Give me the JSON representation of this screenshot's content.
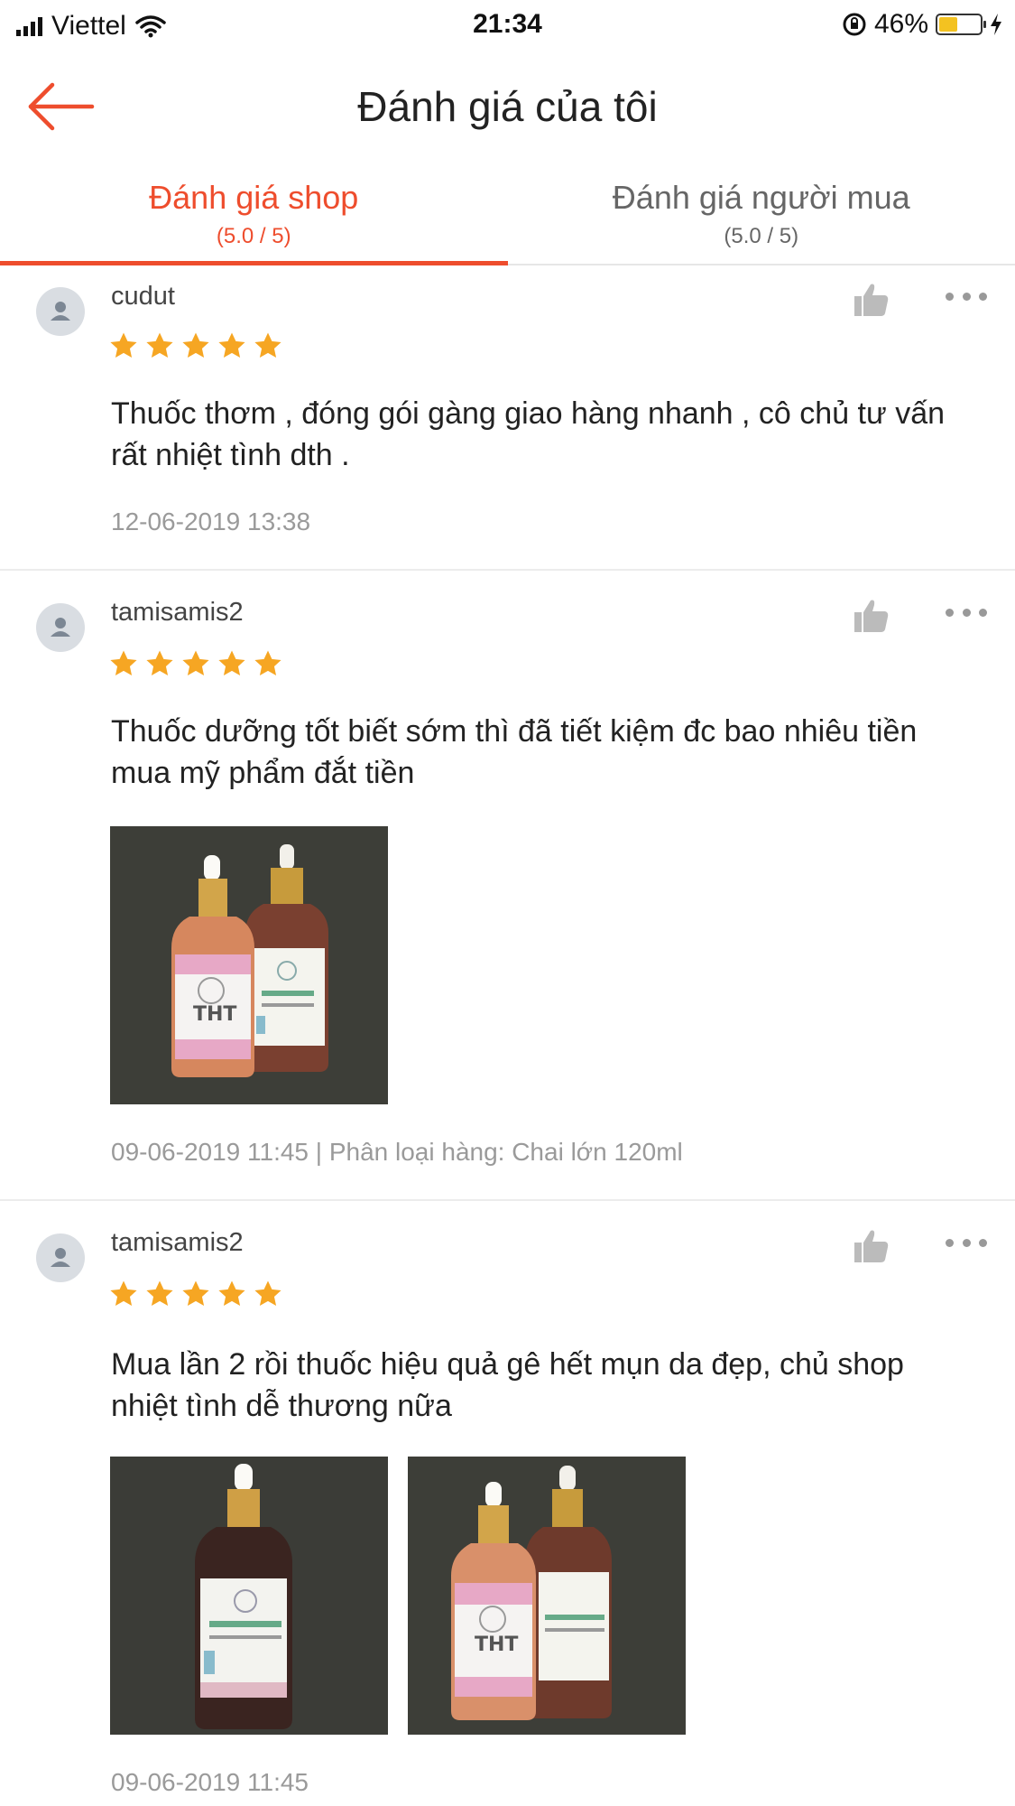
{
  "status_bar": {
    "carrier": "Viettel",
    "time": "21:34",
    "battery_percent": "46%",
    "battery_level": 0.46
  },
  "header": {
    "title": "Đánh giá của tôi"
  },
  "tabs": [
    {
      "label": "Đánh giá shop",
      "score": "(5.0 / 5)",
      "active": true
    },
    {
      "label": "Đánh giá người mua",
      "score": "(5.0 / 5)",
      "active": false
    }
  ],
  "reviews": [
    {
      "username": "cudut",
      "rating": 5,
      "text": "Thuốc thơm , đóng gói gàng giao hàng nhanh , cô chủ tư vấn rất nhiệt tình dth .",
      "meta": "12-06-2019 13:38",
      "photos": []
    },
    {
      "username": "tamisamis2",
      "rating": 5,
      "text": "Thuốc dưỡng tốt biết sớm thì đã tiết kiệm đc bao nhiêu tiền mua mỹ phẩm đắt tiền",
      "meta": "09-06-2019 11:45 | Phân loại hàng: Chai lớn 120ml",
      "photos": [
        "two-bottles-photo"
      ]
    },
    {
      "username": "tamisamis2",
      "rating": 5,
      "text": "Mua lần 2 rồi thuốc hiệu quả gê hết mụn da đẹp, chủ shop nhiệt tình dễ thương nữa",
      "meta": "09-06-2019 11:45",
      "photos": [
        "dark-bottle-photo",
        "two-bottles-photo"
      ]
    }
  ],
  "colors": {
    "accent": "#ee4d2d",
    "star": "#f6a623",
    "text_secondary": "#9a9a9a"
  }
}
